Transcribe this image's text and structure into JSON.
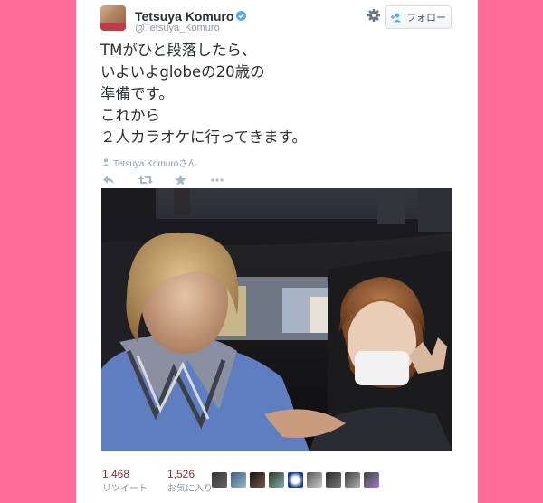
{
  "user": {
    "display_name": "Tetsuya Komuro",
    "handle": "@Tetsuya_Komuro"
  },
  "follow_label": "フォロー",
  "tweet": {
    "text": "TMがひと段落したら、\nいよいよglobeの20歳の\n準備です。\nこれから\n２人カラオケに行ってきます。",
    "context": "Tetsuya Komuroさん"
  },
  "stats": {
    "retweets_count": "1,468",
    "retweets_label": "リツイート",
    "favorites_count": "1,526",
    "favorites_label": "お気に入り"
  },
  "icons": [
    "settings-gear-icon",
    "follow-person-icon",
    "reply-icon",
    "retweet-icon",
    "favorite-star-icon",
    "more-icon",
    "verified-badge-icon"
  ],
  "colors": {
    "page_bg": "#ff6b9a",
    "accent": "#55acee",
    "count_color": "#8e2d2d"
  }
}
